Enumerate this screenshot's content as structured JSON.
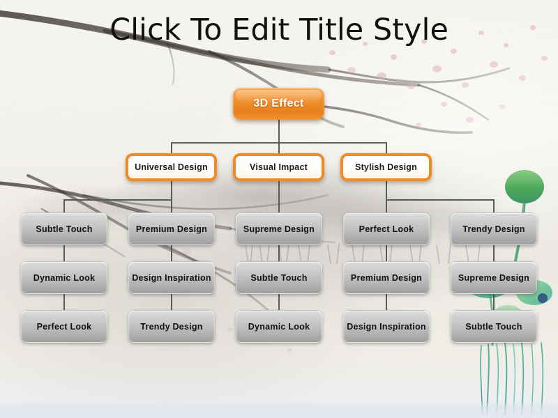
{
  "slide": {
    "title": "Click To Edit Title Style",
    "background_style": "chinese-ink-wash-rice-paper",
    "colors": {
      "accent_orange": "#f0902e",
      "orange_border": "#f08a22",
      "leaf_gray_top": "#dcdcdc",
      "leaf_gray_bottom": "#9e9e9e",
      "connector": "#5a5a5a",
      "title_text": "#111111",
      "petal_pink": "#e2a8bd",
      "leaf_green": "#4ca64c",
      "stem_teal": "#2f9e8f"
    }
  },
  "diagram": {
    "type": "org-chart",
    "root": {
      "label": "3D Effect"
    },
    "level2": [
      {
        "label": "Universal Design"
      },
      {
        "label": "Visual Impact"
      },
      {
        "label": "Stylish Design"
      }
    ],
    "leaf_columns": [
      {
        "column": 1,
        "items": [
          "Subtle Touch",
          "Dynamic Look",
          "Perfect Look"
        ]
      },
      {
        "column": 2,
        "items": [
          "Premium Design",
          "Design Inspiration",
          "Trendy Design"
        ]
      },
      {
        "column": 3,
        "items": [
          "Supreme Design",
          "Subtle Touch",
          "Dynamic Look"
        ]
      },
      {
        "column": 4,
        "items": [
          "Perfect Look",
          "Premium Design",
          "Design Inspiration"
        ]
      },
      {
        "column": 5,
        "items": [
          "Trendy Design",
          "Supreme Design",
          "Subtle Touch"
        ]
      }
    ]
  }
}
